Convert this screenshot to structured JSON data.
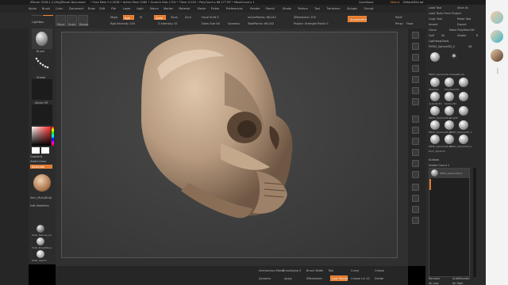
{
  "titlebar": {
    "app": "ZBrush 2018.1.2 [Ms]",
    "doc": "ZBrush Document",
    "stats": "• Free Mem 9.113GB • Active Mem 2265 • Scratch Disk 1704 • Timer 0.030 • PolyCount ▸ 66.177 KP • MeshCount ▸ 1",
    "quicksave": "QuickSave",
    "menus_label": "Menus",
    "ui_label": "DefaultZScript"
  },
  "menubar": [
    "Alpha",
    "Brush",
    "Color",
    "Document",
    "Draw",
    "Edit",
    "File",
    "Layer",
    "Light",
    "Macro",
    "Marker",
    "Material",
    "Movie",
    "Picker",
    "Preferences",
    "Render",
    "Stencil",
    "Stroke",
    "Texture",
    "Tool",
    "Transform",
    "Zplugin",
    "Zscript"
  ],
  "toolbar": {
    "buttons": [
      "Edit",
      "Draw",
      "Move",
      "Scale",
      "Rotate"
    ],
    "mrgb": "Mrgb",
    "rgb": "Rgb",
    "m": "M",
    "rgb_intensity": "Rgb Intensity 100",
    "zadd": "Zadd",
    "zsub": "Zsub",
    "zcut": "Zcut",
    "focal_shift": "Focal Shift 0",
    "z_intensity": "Z Intensity 10",
    "draw_size": "Draw Size 64",
    "dynamic": "Dynamic",
    "active_points": "ActivePoints: 66,042",
    "total_points": "TotalPoints: 66,042",
    "remesher": "ZRemesher 100",
    "project": "Project",
    "strength": "Strength",
    "polish": "Polish 0",
    "sculptrisPro": "SculptrisPro",
    "polyf": "PolyF",
    "persp": "Persp",
    "floor": "Floor"
  },
  "leftpanel": {
    "lightbox": "LightBox",
    "brush_label": "Brush",
    "stroke_label": "Stroke",
    "alpha_label": "Alpha Off",
    "texture_label": "Texture Off",
    "gradient": "Gradient",
    "switch_color": "SwitchColor",
    "alternate": "Alternate",
    "material_label": "Skin_Multi(Bnd)",
    "edit_modifiers": "Edit Modifiers",
    "mat_items": [
      "Multi_Matcap_01",
      "Multi_BrightPane",
      "Multi_Sketch"
    ]
  },
  "rightpanel": {
    "buttons": [
      "Load Tool",
      "Save As",
      "Load Tools From Project",
      "Copy Tool",
      "Paste Tool",
      "Import",
      "Export",
      "Clone",
      "Make PolyMesh3D",
      "GoZ",
      "All",
      "Visible",
      "R"
    ],
    "lightbox_tools": "Lightbox▸Tools",
    "current_tool": "PM3D_Sphere3D_0",
    "tool_count": "48",
    "tools": [
      "PM3D_Sphere3D",
      "SimpleBrush",
      "ZSphere",
      "PolyMesh3D",
      "Cylinder3D",
      "Sphere3D",
      "PM3D_Sphere3D_1",
      "Ring3D",
      "PM3D_Sphere3D_2",
      "PM3D_Sphere3D_3",
      "PM3D_Sphere3D_4",
      "PM3D_Sphere3D_5",
      "Hum_Pyramid"
    ],
    "subtool": "Subtool",
    "visible_count": "Visible Count 1",
    "subtool_item": "PM3D_Sphere3D_0",
    "rename": "Rename",
    "autoreorder": "AutoReorder",
    "all_low": "All Low",
    "all_high": "All High"
  },
  "bottom": {
    "row1": [
      "Intersection Mask",
      "BrushAlpha 0",
      "Brush Width",
      "Roll",
      "Curve",
      "Crease"
    ],
    "row2": [
      "Dynamic",
      "Apply",
      "ZRemesher",
      "Lazy Mouse",
      "Crease Lvl 15",
      "Divide"
    ]
  },
  "webcam_colors": [
    "#7fc6c9",
    "#3bb5c9",
    "#e6c9a8"
  ]
}
